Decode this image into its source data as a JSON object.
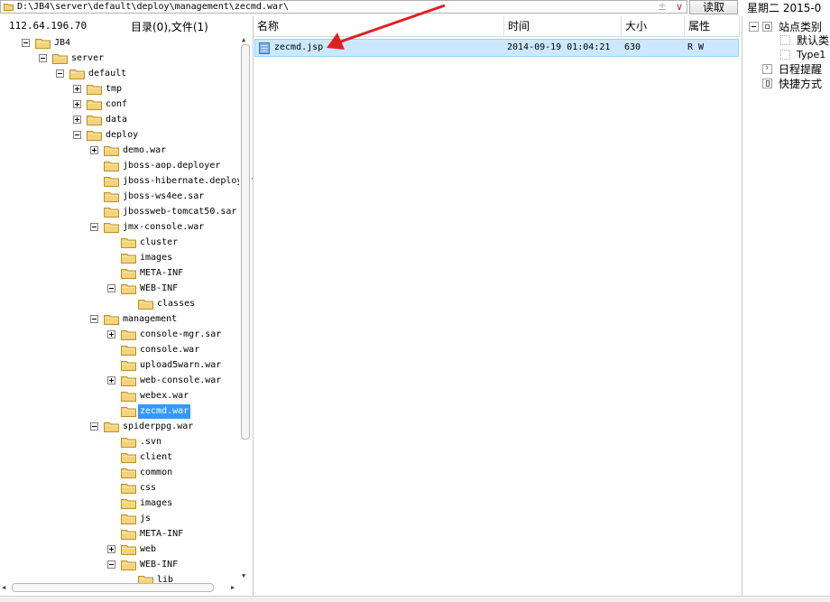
{
  "path_bar": {
    "value": "D:\\JB4\\server\\default\\deploy\\management\\zecmd.war\\",
    "plus_symbol": "±",
    "dropdown_symbol": "∨"
  },
  "read_button": "读取",
  "date_info": "星期二 2015-0",
  "tree_header": {
    "ip": "112.64.196.70",
    "counts": "目录(0),文件(1)"
  },
  "file_list": {
    "columns": [
      "名称",
      "时间",
      "大小",
      "属性"
    ],
    "rows": [
      {
        "name": "zecmd.jsp",
        "time": "2014-09-19 01:04:21",
        "size": "630",
        "attr": "R W"
      }
    ]
  },
  "tree": [
    {
      "label": "JB4",
      "toggle": "minus"
    },
    {
      "label": "server",
      "toggle": "minus"
    },
    {
      "label": "default",
      "toggle": "minus"
    },
    {
      "label": "tmp",
      "toggle": "plus"
    },
    {
      "label": "conf",
      "toggle": "plus"
    },
    {
      "label": "data",
      "toggle": "plus"
    },
    {
      "label": "deploy",
      "toggle": "minus"
    },
    {
      "label": "demo.war",
      "toggle": "plus"
    },
    {
      "label": "jboss-aop.deployer",
      "toggle": "none"
    },
    {
      "label": "jboss-hibernate.deployer",
      "toggle": "none"
    },
    {
      "label": "jboss-ws4ee.sar",
      "toggle": "none"
    },
    {
      "label": "jbossweb-tomcat50.sar",
      "toggle": "none"
    },
    {
      "label": "jmx-console.war",
      "toggle": "minus"
    },
    {
      "label": "cluster",
      "toggle": "none"
    },
    {
      "label": "images",
      "toggle": "none"
    },
    {
      "label": "META-INF",
      "toggle": "none"
    },
    {
      "label": "WEB-INF",
      "toggle": "minus"
    },
    {
      "label": "classes",
      "toggle": "none"
    },
    {
      "label": "management",
      "toggle": "minus"
    },
    {
      "label": "console-mgr.sar",
      "toggle": "plus"
    },
    {
      "label": "console.war",
      "toggle": "none"
    },
    {
      "label": "upload5warn.war",
      "toggle": "none"
    },
    {
      "label": "web-console.war",
      "toggle": "plus"
    },
    {
      "label": "webex.war",
      "toggle": "none"
    },
    {
      "label": "zecmd.war",
      "toggle": "none",
      "selected": true
    },
    {
      "label": "spiderppg.war",
      "toggle": "minus"
    },
    {
      "label": ".svn",
      "toggle": "none"
    },
    {
      "label": "client",
      "toggle": "none"
    },
    {
      "label": "common",
      "toggle": "none"
    },
    {
      "label": "css",
      "toggle": "none"
    },
    {
      "label": "images",
      "toggle": "none"
    },
    {
      "label": "js",
      "toggle": "none"
    },
    {
      "label": "META-INF",
      "toggle": "none"
    },
    {
      "label": "web",
      "toggle": "plus"
    },
    {
      "label": "WEB-INF",
      "toggle": "minus"
    },
    {
      "label": "lib",
      "toggle": "none"
    }
  ],
  "right_panel": {
    "category": "站点类别",
    "default_category": "默认类",
    "type1": "Type1",
    "schedule": "日程提醒",
    "shortcuts": "快捷方式"
  },
  "colors": {
    "selection": "#3399ff",
    "row_highlight": "#cce8ff",
    "annotation_arrow": "#e02020",
    "folder": "#f5d37a"
  }
}
